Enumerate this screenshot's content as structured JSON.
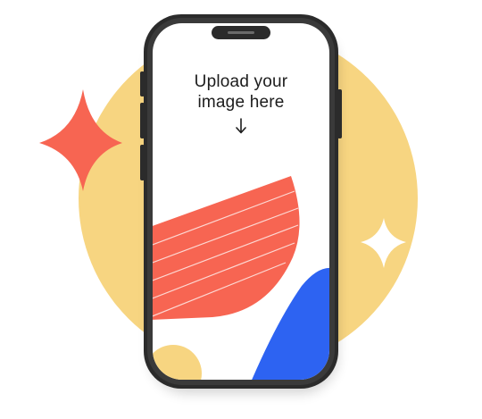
{
  "upload_prompt": {
    "line1": "Upload your",
    "line2": "image here",
    "icon": "arrow-down-icon"
  },
  "colors": {
    "yellow_blob": "#F7D581",
    "red_accent": "#F76552",
    "blue_accent": "#2D63F2",
    "phone_frame": "#2B2B2B",
    "screen": "#FFFFFF",
    "sparkle_light": "#FFFFFF"
  }
}
